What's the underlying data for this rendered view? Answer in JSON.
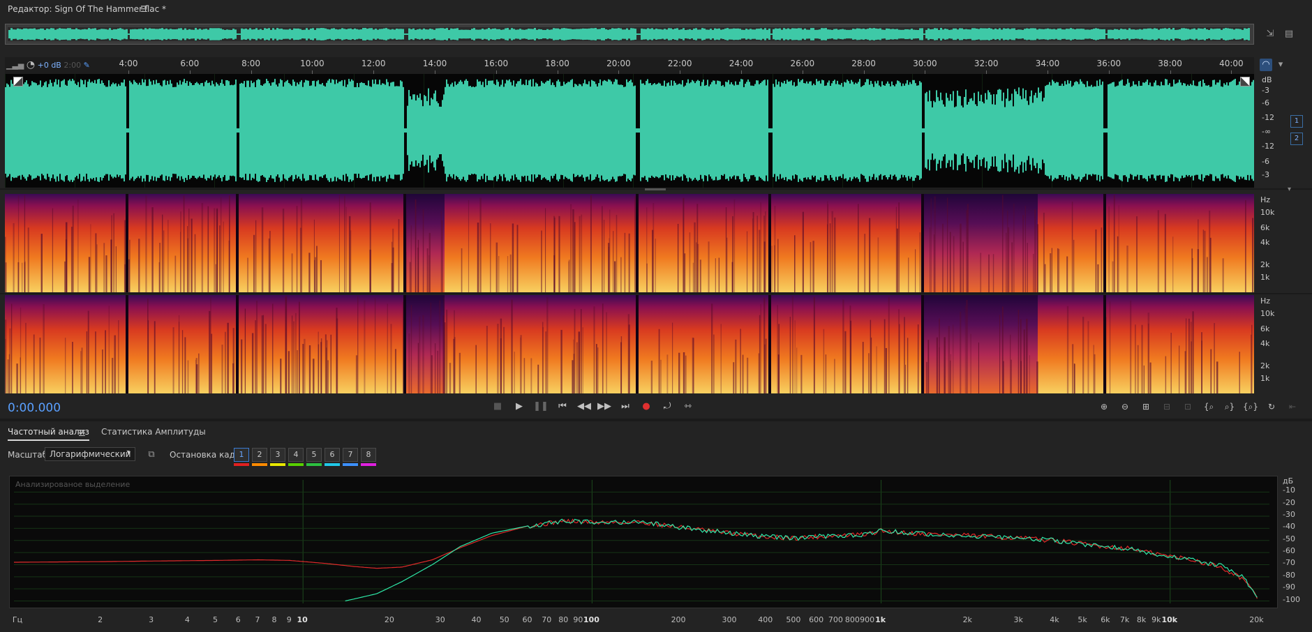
{
  "editor": {
    "title": "Редактор: Sign Of The Hammer.flac *"
  },
  "ruler": {
    "labels": [
      "4:00",
      "6:00",
      "8:00",
      "10:00",
      "12:00",
      "14:00",
      "16:00",
      "18:00",
      "20:00",
      "22:00",
      "24:00",
      "26:00",
      "28:00",
      "30:00",
      "32:00",
      "34:00",
      "36:00",
      "38:00",
      "40:00"
    ]
  },
  "hud": {
    "volume": "+0 dB",
    "ghost": "2:00"
  },
  "waveform_scale": {
    "labels": [
      "dB",
      "-3",
      "-6",
      "-12",
      "-∞",
      "-12",
      "-6",
      "-3"
    ]
  },
  "channels": [
    "1",
    "2"
  ],
  "spectral_scale": {
    "labels": [
      "Hz",
      "10k",
      "6k",
      "4k",
      "2k",
      "1k"
    ]
  },
  "transport": {
    "time": "0:00.000"
  },
  "panel": {
    "tabs": [
      "Частотный анализ",
      "Статистика Амплитуды"
    ],
    "scale_label": "Масштаб:",
    "scale_value": "Логарифмический",
    "hold_label": "Остановка кадра:",
    "frames": [
      "1",
      "2",
      "3",
      "4",
      "5",
      "6",
      "7",
      "8"
    ],
    "frame_colors": [
      "#e02020",
      "#ff8a00",
      "#e8e800",
      "#58d000",
      "#2cc040",
      "#20c8e8",
      "#3c90ff",
      "#e020e0"
    ],
    "analyzed_hint": "Анализированое выделение"
  },
  "chart_data": {
    "type": "line",
    "xscale": "log",
    "xlim": [
      1,
      22050
    ],
    "ylim": [
      -102,
      0
    ],
    "xlabel": "Гц",
    "ylabel": "дБ",
    "x_ticks": [
      "Гц",
      "2",
      "3",
      "4",
      "5",
      "6",
      "7",
      "8",
      "9",
      "10",
      "20",
      "30",
      "40",
      "50",
      "60",
      "70",
      "80",
      "90",
      "100",
      "200",
      "300",
      "400",
      "500",
      "600",
      "700",
      "800",
      "900",
      "1k",
      "2k",
      "3k",
      "4k",
      "5k",
      "6k",
      "7k",
      "8k",
      "9k",
      "10k",
      "20k"
    ],
    "y_ticks": [
      "дБ",
      "-10",
      "-20",
      "-30",
      "-40",
      "-50",
      "-60",
      "-70",
      "-80",
      "-90",
      "-100"
    ],
    "series": [
      {
        "color": "#e02a2a",
        "x": [
          1,
          2,
          3,
          5,
          7,
          9,
          12,
          15,
          18,
          22,
          28,
          35,
          45,
          60,
          80,
          100,
          150,
          200,
          300,
          400,
          500,
          700,
          900,
          1000,
          1300,
          2000,
          3000,
          4000,
          5000,
          6000,
          7500,
          8000,
          10000,
          12000,
          15000,
          18000,
          20000
        ],
        "y": [
          -68,
          -67.5,
          -67,
          -66.5,
          -66,
          -66.5,
          -69,
          -71.5,
          -73,
          -72,
          -66,
          -56,
          -46,
          -38,
          -34,
          -35,
          -35,
          -39,
          -44,
          -47,
          -48,
          -46,
          -45,
          -42,
          -44,
          -46,
          -48,
          -50,
          -53,
          -55,
          -57,
          -59,
          -63,
          -66,
          -72,
          -82,
          -98
        ]
      },
      {
        "color": "#2ee8a8",
        "x": [
          14,
          18,
          22,
          28,
          35,
          45,
          60,
          80,
          100,
          150,
          200,
          300,
          400,
          500,
          700,
          900,
          1000,
          1300,
          2000,
          3000,
          4000,
          5000,
          6000,
          7500,
          8000,
          10000,
          12000,
          15000,
          18000,
          20000
        ],
        "y": [
          -100,
          -94,
          -84,
          -70,
          -55,
          -44,
          -38,
          -34,
          -35,
          -35,
          -39,
          -44,
          -47,
          -48,
          -46,
          -45,
          -42,
          -44,
          -46,
          -48,
          -50,
          -53,
          -55,
          -57,
          -59,
          -63,
          -66,
          -71,
          -81,
          -97
        ]
      }
    ]
  },
  "colors": {
    "wave": "#3ec9a7",
    "accent": "#3a7bd5",
    "time": "#5aa0ff",
    "record": "#e03030"
  }
}
